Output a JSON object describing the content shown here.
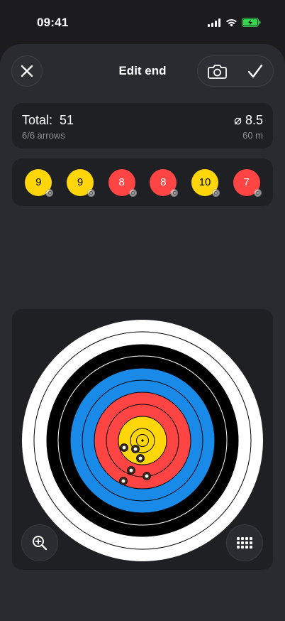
{
  "status": {
    "time": "09:41"
  },
  "nav": {
    "title": "Edit end",
    "close_icon": "close-icon",
    "camera_icon": "camera-icon",
    "confirm_icon": "checkmark-icon"
  },
  "summary": {
    "total_label": "Total:",
    "total_value": "51",
    "arrows": "6/6 arrows",
    "average": "⌀ 8.5",
    "distance": "60 m"
  },
  "scores": [
    {
      "value": "9",
      "color": "#ffd60a",
      "text_color": "#000000"
    },
    {
      "value": "9",
      "color": "#ffd60a",
      "text_color": "#000000"
    },
    {
      "value": "8",
      "color": "#ff4444",
      "text_color": "#ffffff"
    },
    {
      "value": "8",
      "color": "#ff4444",
      "text_color": "#ffffff"
    },
    {
      "value": "10",
      "color": "#ffd60a",
      "text_color": "#000000"
    },
    {
      "value": "7",
      "color": "#ff4444",
      "text_color": "#ffffff"
    }
  ],
  "target": {
    "colors": {
      "white": "#ffffff",
      "black": "#000000",
      "blue": "#1a8ae8",
      "red": "#ff4444",
      "yellow": "#ffd60a"
    }
  },
  "controls": {
    "zoom_icon": "zoom-in-icon",
    "keypad_icon": "keypad-icon"
  }
}
